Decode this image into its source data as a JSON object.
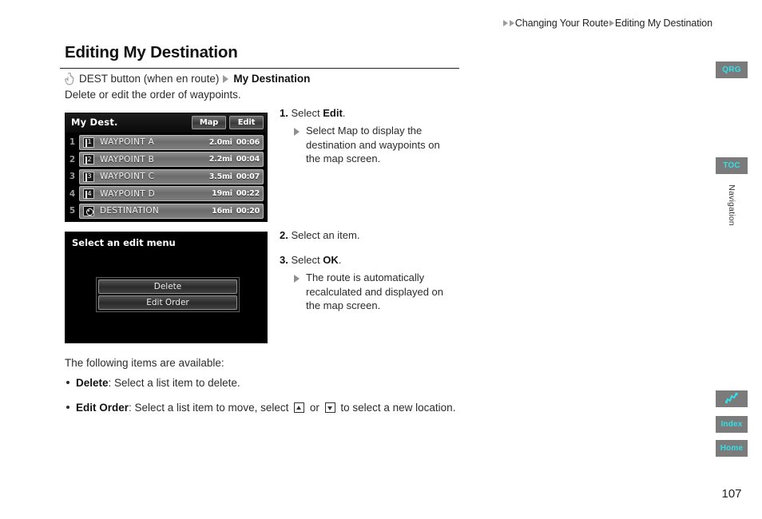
{
  "breadcrumb": {
    "part1": "Changing Your Route",
    "part2": "Editing My Destination"
  },
  "heading": "Editing My Destination",
  "nav_path": {
    "icon": "hand-pointer-icon",
    "text": "DEST button (when en route)",
    "target": "My Destination"
  },
  "intro": "Delete or edit the order of waypoints.",
  "screens": {
    "destination": {
      "title": "My Dest.",
      "buttons": [
        {
          "label": "Map"
        },
        {
          "label": "Edit"
        }
      ],
      "rows": [
        {
          "num": "1",
          "icon": "waypoint-flag-icon",
          "flag": "1",
          "name": "WAYPOINT A",
          "distance": "2.0mi",
          "time": "00:06"
        },
        {
          "num": "2",
          "icon": "waypoint-flag-icon",
          "flag": "2",
          "name": "WAYPOINT B",
          "distance": "2.2mi",
          "time": "00:04"
        },
        {
          "num": "3",
          "icon": "waypoint-flag-icon",
          "flag": "3",
          "name": "WAYPOINT C",
          "distance": "3.5mi",
          "time": "00:07"
        },
        {
          "num": "4",
          "icon": "waypoint-flag-icon",
          "flag": "4",
          "name": "WAYPOINT D",
          "distance": "19mi",
          "time": "00:22"
        },
        {
          "num": "5",
          "icon": "destination-target-icon",
          "flag": "",
          "name": "DESTINATION",
          "distance": "16mi",
          "time": "00:20"
        }
      ]
    },
    "edit_menu": {
      "title": "Select an edit menu",
      "options": [
        {
          "label": "Delete"
        },
        {
          "label": "Edit Order"
        }
      ]
    }
  },
  "steps": {
    "step1": {
      "num": "1.",
      "pre": "Select ",
      "bold": "Edit",
      "post": "."
    },
    "step1_sub": {
      "pre": "Select ",
      "bold": "Map",
      "post": " to display the destination and waypoints on the map screen."
    },
    "step2": {
      "num": "2.",
      "text": "Select an item."
    },
    "step3": {
      "num": "3.",
      "pre": "Select ",
      "bold": "OK",
      "post": "."
    },
    "step3_sub": {
      "text": "The route is automatically recalculated and displayed on the map screen."
    }
  },
  "available": {
    "intro": "The following items are available:",
    "items": [
      {
        "bold": "Delete",
        "rest": ": Select a list item to delete."
      },
      {
        "bold": "Edit Order",
        "rest_pre": ": Select a list item to move, select ",
        "arrow_up": "up-arrow-key-icon",
        "rest_mid": " or ",
        "arrow_down": "down-arrow-key-icon",
        "rest_post": " to select a new location."
      }
    ]
  },
  "sidebar": {
    "tabs": [
      {
        "id": "qrg",
        "label": "QRG"
      },
      {
        "id": "toc",
        "label": "TOC"
      },
      {
        "id": "map",
        "label": ""
      },
      {
        "id": "index",
        "label": "Index"
      },
      {
        "id": "home",
        "label": "Home"
      }
    ],
    "section_label": "Navigation",
    "accent_color": "#31e0e8",
    "tab_bg": "#7b7b7b"
  },
  "page_number": "107"
}
